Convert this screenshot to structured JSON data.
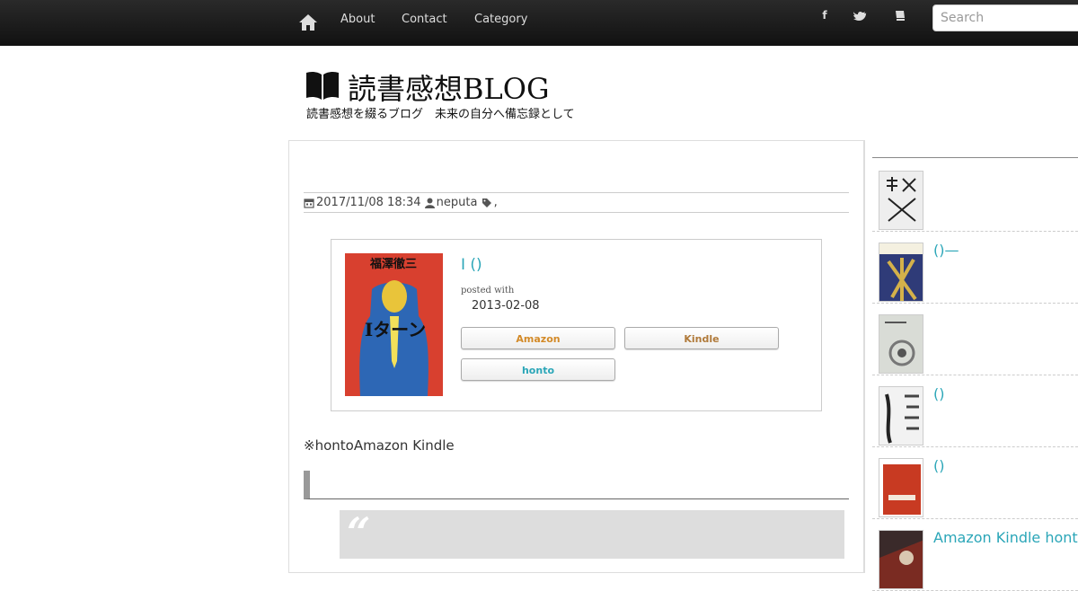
{
  "nav": {
    "links": [
      "About",
      "Contact",
      "Category"
    ],
    "social": [
      "f",
      "t",
      "b"
    ],
    "search_placeholder": "Search"
  },
  "logo": {
    "title": "読書感想BLOG",
    "subtitle": "読書感想を綴るブログ　未来の自分へ備忘録として"
  },
  "post": {
    "date": "2017/11/08 18:34",
    "author": "neputa",
    "tags": ","
  },
  "book": {
    "title": "I ()",
    "posted_with": "posted with",
    "date": "2013-02-08",
    "cover_author": "福澤徹三",
    "cover_title": "Iターン",
    "stores": [
      {
        "label": "Amazon",
        "color": "#d38a28"
      },
      {
        "label": "Kindle",
        "color": "#b07a3a"
      },
      {
        "label": "honto",
        "color": "#2ba6b8"
      }
    ]
  },
  "note": "※hontoAmazon Kindle",
  "quote_mark": "“",
  "sidebar": [
    {
      "text": "",
      "thumb": "white-kanji"
    },
    {
      "text": "()—",
      "thumb": "blue-gold"
    },
    {
      "text": "",
      "thumb": "grey-spiral"
    },
    {
      "text": "()",
      "thumb": "ink"
    },
    {
      "text": "()",
      "thumb": "red-square"
    },
    {
      "text": "Amazon Kindle  honto",
      "thumb": "dark"
    }
  ],
  "colors": {
    "accent": "#2ba6b8",
    "topbar": "#1a1a1a"
  }
}
